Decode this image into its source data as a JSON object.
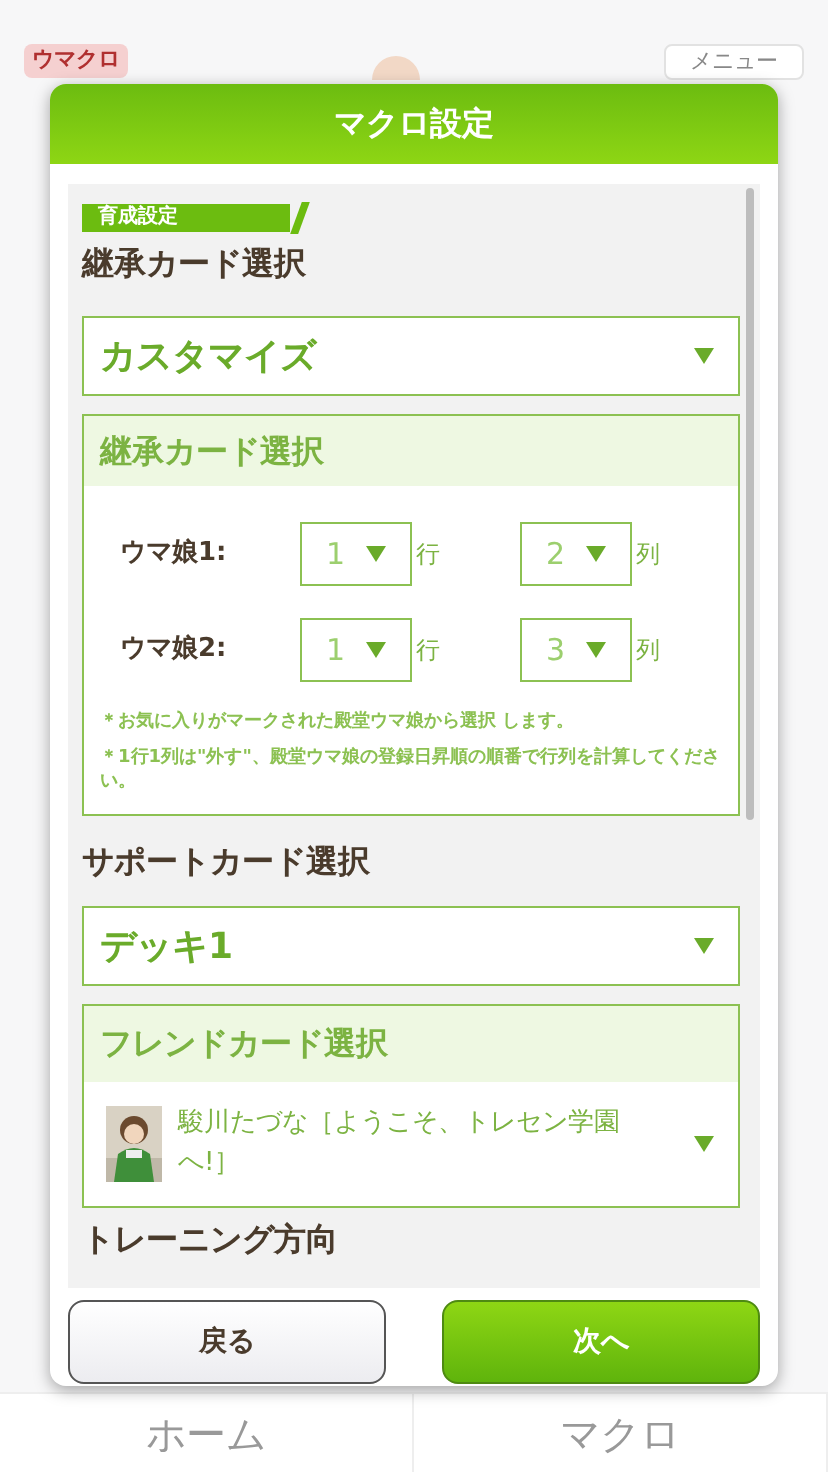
{
  "background": {
    "logo": "ウマクロ",
    "menu_button": "メニュー",
    "nav": [
      "ホーム",
      "マクロ"
    ]
  },
  "dialog": {
    "title": "マクロ設定",
    "section_tag": "育成設定",
    "inherit": {
      "heading": "継承カード選択",
      "dropdown": "カスタマイズ",
      "panel_title": "継承カード選択",
      "rows": [
        {
          "label": "ウマ娘1:",
          "row": "1",
          "row_unit": "行",
          "col": "2",
          "col_unit": "列"
        },
        {
          "label": "ウマ娘2:",
          "row": "1",
          "row_unit": "行",
          "col": "3",
          "col_unit": "列"
        }
      ],
      "notes": [
        "＊お気に入りがマークされた殿堂ウマ娘から選択 します。",
        "＊1行1列は\"外す\"、殿堂ウマ娘の登録日昇順の順番で行列を計算してください。"
      ]
    },
    "support": {
      "heading": "サポートカード選択",
      "dropdown": "デッキ1",
      "panel_title": "フレンドカード選択",
      "friend_card": "駿川たづな［ようこそ、トレセン学園へ!］"
    },
    "next_heading": "トレーニング方向",
    "buttons": [
      {
        "label": "戻る",
        "kind": "secondary"
      },
      {
        "label": "次へ",
        "kind": "primary"
      }
    ]
  }
}
